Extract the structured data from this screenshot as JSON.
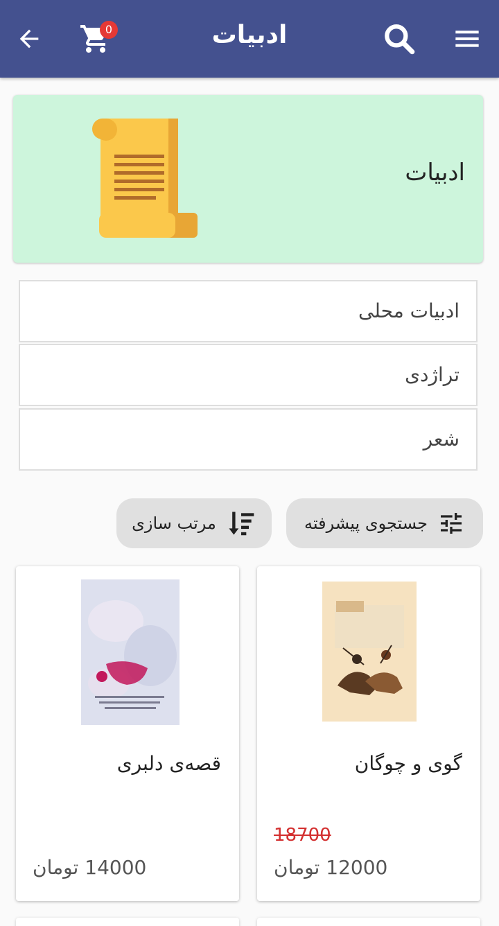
{
  "appbar": {
    "title": "ادبیات",
    "cart_count": "0",
    "icons": [
      "back-arrow-icon",
      "cart-icon",
      "search-icon",
      "menu-icon"
    ],
    "color": "#44518f"
  },
  "category": {
    "title": "ادبیات",
    "icon": "scroll-icon",
    "background": "#cdf5dc"
  },
  "subcategories": [
    {
      "label": "ادبیات محلی"
    },
    {
      "label": "تراژدی"
    },
    {
      "label": "شعر"
    }
  ],
  "actions": {
    "advanced_search": "جستجوی پیشرفته",
    "sort": "مرتب سازی"
  },
  "products": [
    {
      "name": "گوی و چوگان",
      "old_price": "18700",
      "price": "12000 تومان"
    },
    {
      "name": "قصه‌ی دلبری",
      "old_price": "",
      "price": "14000 تومان"
    }
  ]
}
